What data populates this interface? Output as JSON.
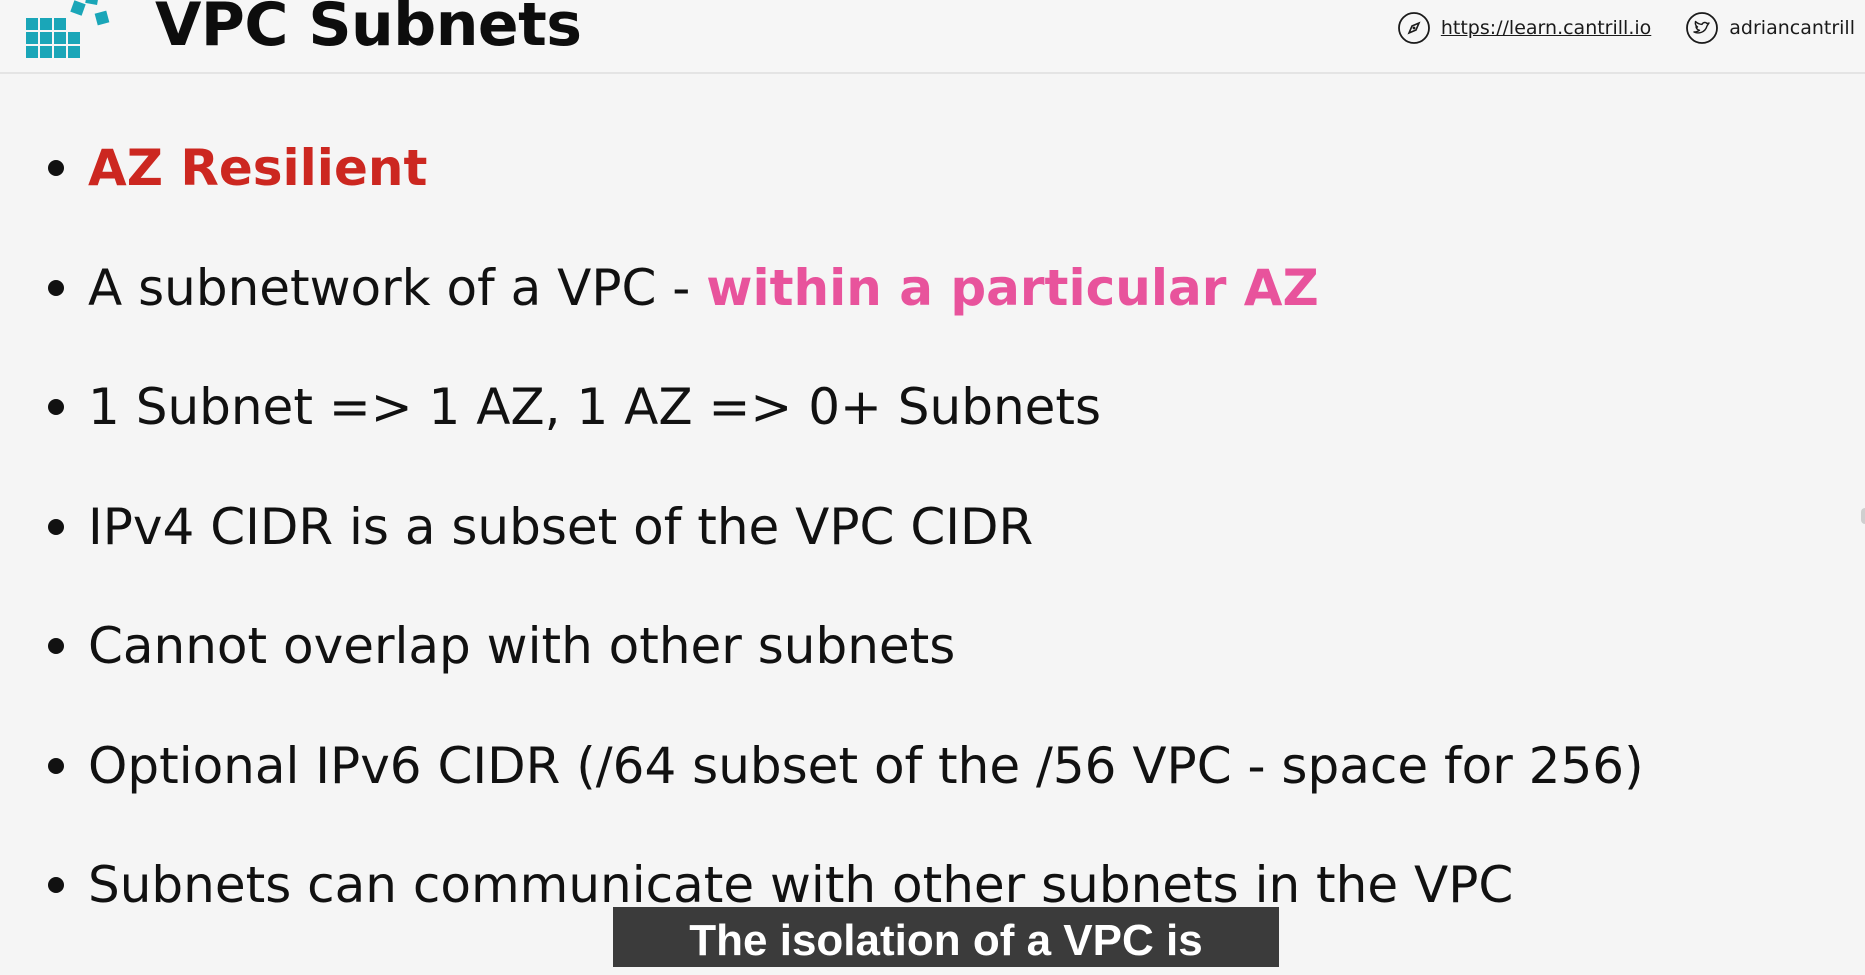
{
  "header": {
    "title": "VPC Subnets",
    "website_url": "https://learn.cantrill.io",
    "twitter_handle": "adriancantrill",
    "website_icon": "compass-icon",
    "twitter_icon": "twitter-icon",
    "logo_icon": "blocks-logo-icon",
    "logo_color": "#1aa6b8"
  },
  "bullets": [
    {
      "text": "AZ Resilient",
      "color": "#cc2720"
    },
    {
      "prefix": "A subnetwork of a VPC - ",
      "highlight": "within a particular AZ",
      "highlight_color": "#e8539c"
    },
    {
      "text": "1 Subnet => 1 AZ, 1 AZ => 0+ Subnets"
    },
    {
      "text": "IPv4 CIDR is a subset of the VPC CIDR"
    },
    {
      "text": "Cannot overlap with other subnets"
    },
    {
      "text": "Optional IPv6 CIDR (/64 subset of the /56 VPC - space for 256)"
    },
    {
      "text": "Subnets can communicate with other subnets in the VPC"
    }
  ],
  "caption": {
    "text": "The isolation of a VPC is"
  }
}
